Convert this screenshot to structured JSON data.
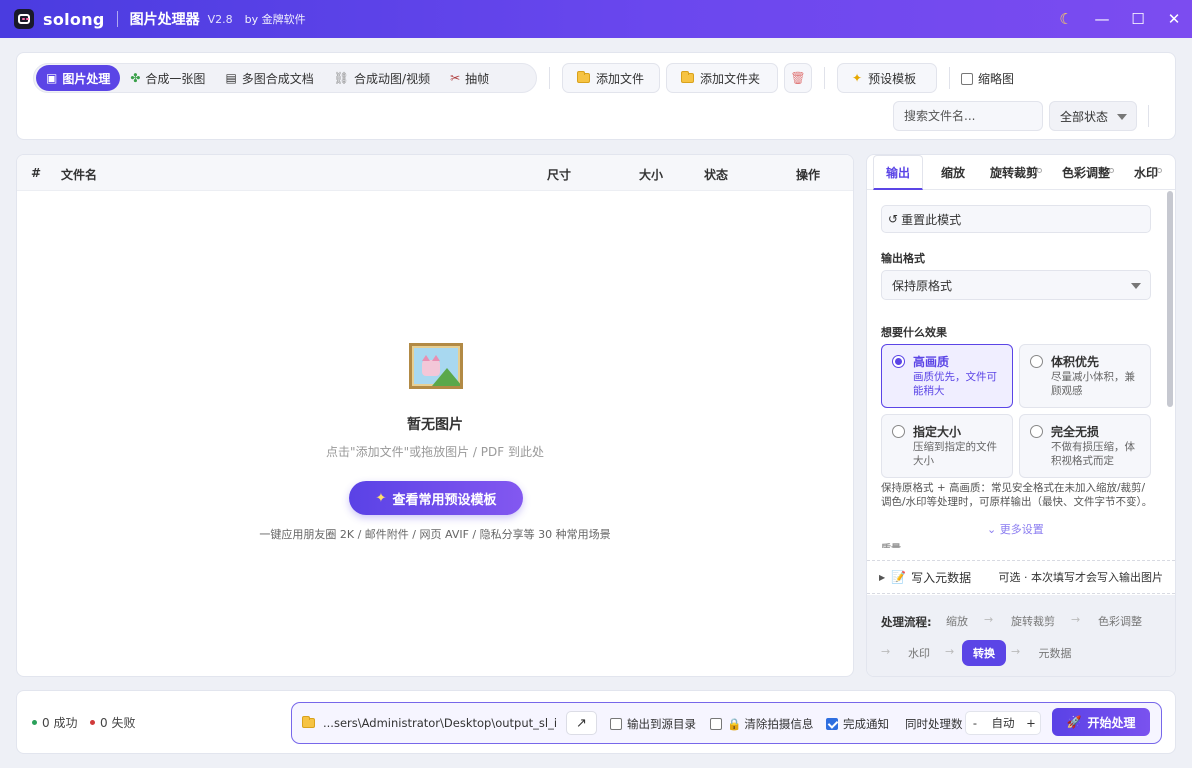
{
  "titlebar": {
    "brand": "solong",
    "title": "图片处理器",
    "version": "V2.8",
    "byline": "by 金牌软件",
    "theme_icon": "moon-icon",
    "window_controls": [
      "minimize-icon",
      "maximize-icon",
      "close-icon"
    ]
  },
  "toolbar": {
    "modes": [
      {
        "label": "图片处理",
        "icon": "image-icon",
        "active": true
      },
      {
        "label": "合成一张图",
        "icon": "puzzle-icon",
        "active": false
      },
      {
        "label": "多图合成文档",
        "icon": "document-icon",
        "active": false
      },
      {
        "label": "合成动图/视频",
        "icon": "link-icon",
        "active": false
      },
      {
        "label": "抽帧",
        "icon": "film-icon",
        "active": false
      }
    ],
    "add_file": "添加文件",
    "add_folder": "添加文件夹",
    "preset_template": "预设模板",
    "thumbnail_label": "缩略图",
    "thumbnail_checked": false,
    "search_placeholder": "搜索文件名...",
    "status_filter": "全部状态"
  },
  "file_list": {
    "columns": [
      "#",
      "文件名",
      "尺寸",
      "大小",
      "状态",
      "操作"
    ],
    "empty_title": "暂无图片",
    "empty_hint": "点击\"添加文件\"或拖放图片 / PDF 到此处",
    "preset_button": "查看常用预设模板",
    "scenes_hint": "一键应用朋友圈 2K / 邮件附件 / 网页 AVIF / 隐私分享等 30 种常用场景"
  },
  "side_panel": {
    "tabs": [
      {
        "label": "输出",
        "active": true
      },
      {
        "label": "缩放",
        "active": false
      },
      {
        "label": "旋转裁剪",
        "active": false
      },
      {
        "label": "色彩调整",
        "active": false
      },
      {
        "label": "水印",
        "active": false
      }
    ],
    "reset_button": "重置此模式",
    "output_format_label": "输出格式",
    "output_format_value": "保持原格式",
    "effect_label": "想要什么效果",
    "effects": [
      {
        "title": "高画质",
        "desc": "画质优先，文件可能稍大",
        "selected": true
      },
      {
        "title": "体积优先",
        "desc": "尽量减小体积，兼顾观感",
        "selected": false
      },
      {
        "title": "指定大小",
        "desc": "压缩到指定的文件大小",
        "selected": false
      },
      {
        "title": "完全无损",
        "desc": "不做有损压缩，体积视格式而定",
        "selected": false
      }
    ],
    "note": "保持原格式 + 高画质：常见安全格式在未加入缩放/裁剪/调色/水印等处理时，可原样输出（最快、文件字节不变）。",
    "more_settings": "更多设置",
    "cutoff_label": "质量",
    "metadata_label": "写入元数据",
    "metadata_hint": "可选 · 本次填写才会写入输出图片",
    "pipeline_label": "处理流程:",
    "pipeline_steps": [
      {
        "label": "缩放",
        "active": false
      },
      {
        "label": "旋转裁剪",
        "active": false
      },
      {
        "label": "色彩调整",
        "active": false
      },
      {
        "label": "水印",
        "active": false
      },
      {
        "label": "转换",
        "active": true
      },
      {
        "label": "元数据",
        "active": false
      }
    ],
    "arrow": "→"
  },
  "footer": {
    "success": "0 成功",
    "fail": "0 失败",
    "success_color": "#2aa05a",
    "fail_color": "#d03a3a",
    "output_path": "...sers\\Administrator\\Desktop\\output_sl_ip",
    "open_icon": "external-link-icon",
    "output_to_source": "输出到源目录",
    "output_to_source_checked": false,
    "clear_exif": "清除拍摄信息",
    "clear_exif_checked": false,
    "notify_done": "完成通知",
    "notify_done_checked": true,
    "concurrency_label": "同时处理数",
    "concurrency_value": "自动",
    "start_button": "开始处理"
  },
  "colors": {
    "accent": "#5b45e6",
    "titlebar_start": "#4a3ce0",
    "titlebar_end": "#7c4cf0"
  }
}
